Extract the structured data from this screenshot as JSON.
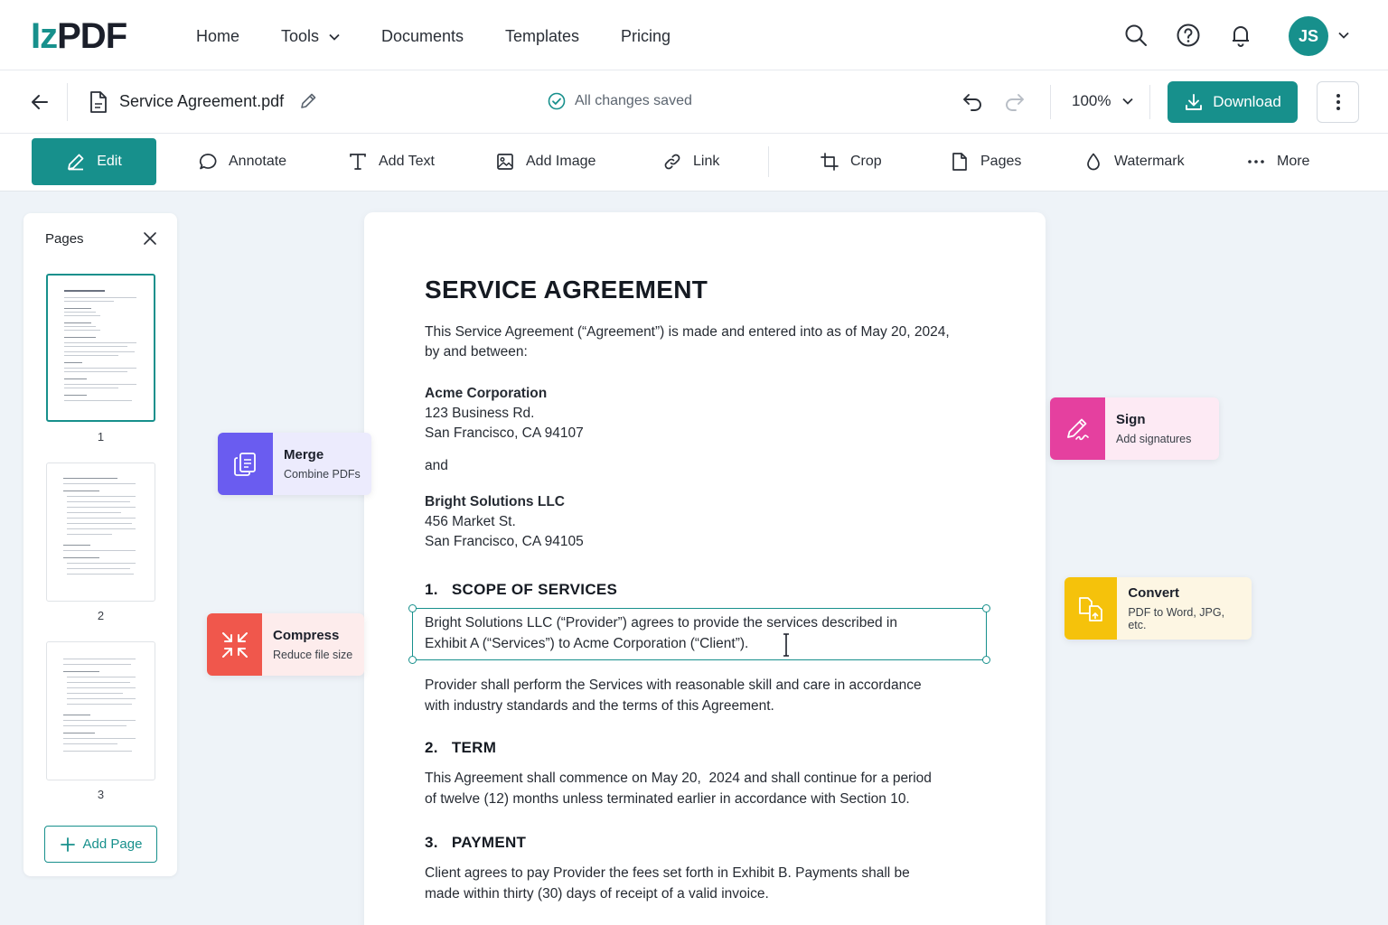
{
  "brand": {
    "logo_prefix": "Iz",
    "logo_suffix": "PDF"
  },
  "nav": {
    "items": [
      "Home",
      "Tools",
      "Documents",
      "Templates",
      "Pricing"
    ],
    "avatar_initials": "JS"
  },
  "file": {
    "name": "Service Agreement.pdf",
    "status": "All changes saved",
    "zoom": "100%",
    "download_label": "Download"
  },
  "toolbar": {
    "edit": "Edit",
    "annotate": "Annotate",
    "add_text": "Add Text",
    "add_image": "Add Image",
    "link": "Link",
    "crop": "Crop",
    "pages": "Pages",
    "watermark": "Watermark",
    "more": "More"
  },
  "pages_panel": {
    "title": "Pages",
    "pages": [
      "1",
      "2",
      "3"
    ],
    "add_label": "Add Page"
  },
  "document": {
    "title": "SERVICE AGREEMENT",
    "intro_line1": "This Service Agreement (“Agreement”) is made and entered into as of May 20, 2024,",
    "intro_line2": "by and between:",
    "party1_name": "Acme Corporation",
    "party1_addr1": "123 Business Rd.",
    "party1_addr2": "San Francisco, CA 94107",
    "and": "and",
    "party2_name": "Bright Solutions LLC",
    "party2_addr1": "456 Market St.",
    "party2_addr2": "San Francisco, CA 94105",
    "s1_title": "1.   SCOPE OF SERVICES",
    "s1_sel_line1": "Bright Solutions LLC (“Provider”) agrees to provide the services described in",
    "s1_sel_line2": "Exhibit A (“Services”) to Acme Corporation (“Client”).",
    "s1_p2_line1": "Provider shall perform the Services with reasonable skill and care in accordance",
    "s1_p2_line2": "with industry standards and the terms of this Agreement.",
    "s2_title": "2.   TERM",
    "s2_line1": "This Agreement shall commence on May 20,  2024 and shall continue for a period",
    "s2_line2": "of twelve (12) months unless terminated earlier in accordance with Section 10.",
    "s3_title": "3.   PAYMENT",
    "s3_line1": "Client agrees to pay Provider the fees set forth in Exhibit B. Payments shall be",
    "s3_line2": "made within thirty (30) days of receipt of a valid invoice."
  },
  "feature_cards": {
    "merge": {
      "title": "Merge",
      "subtitle": "Combine PDFs",
      "color": "#6a5cf0",
      "bg": "#ecebfd"
    },
    "compress": {
      "title": "Compress",
      "subtitle": "Reduce file size",
      "color": "#f0574c",
      "bg": "#fdecec"
    },
    "sign": {
      "title": "Sign",
      "subtitle": "Add signatures",
      "color": "#e5409f",
      "bg": "#fdeaf4"
    },
    "convert": {
      "title": "Convert",
      "subtitle": "PDF to Word, JPG, etc.",
      "color": "#f5c20b",
      "bg": "#fdf6e3"
    }
  },
  "colors": {
    "accent": "#17908c",
    "canvas": "#eef3f8"
  }
}
